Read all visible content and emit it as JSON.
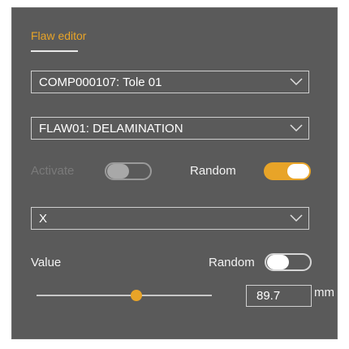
{
  "editor": {
    "title": "Flaw editor",
    "component_select": {
      "value": "COMP000107: Tole 01"
    },
    "flaw_select": {
      "value": "FLAW01: DELAMINATION"
    },
    "activate": {
      "label": "Activate",
      "on": false,
      "disabled": true
    },
    "random_top": {
      "label": "Random",
      "on": true
    },
    "axis_select": {
      "value": "X"
    },
    "value_label": "Value",
    "random_value": {
      "label": "Random",
      "on": false
    },
    "slider": {
      "fraction": 0.57
    },
    "value_input": {
      "value": "89.7"
    },
    "unit": "mm",
    "accent_color": "#e8a428"
  },
  "icons": {
    "dropdown": "chevron-down-icon"
  }
}
